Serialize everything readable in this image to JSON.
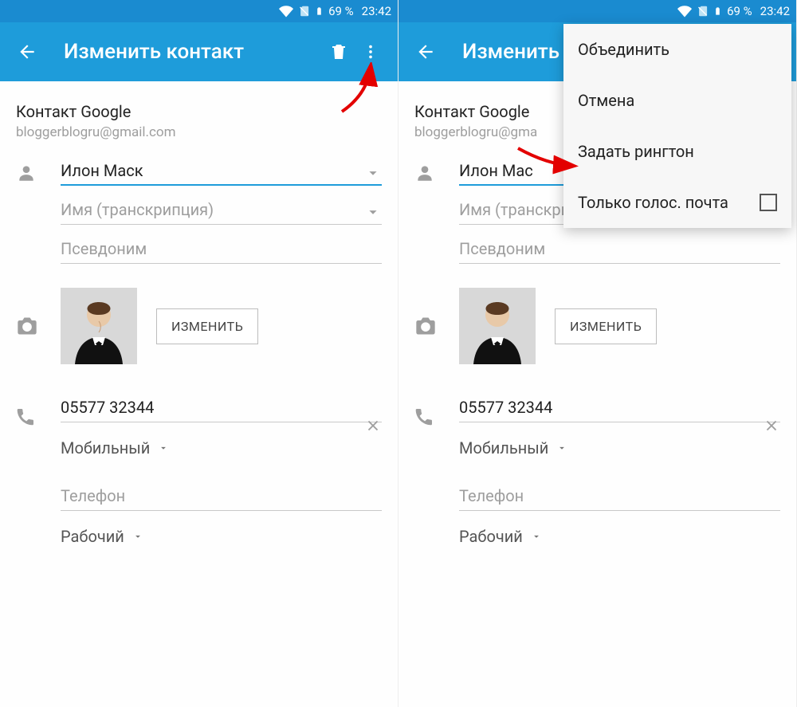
{
  "status": {
    "battery": "69 %",
    "time": "23:42"
  },
  "appbar": {
    "title": "Изменить контакт"
  },
  "account": {
    "label": "Контакт Google",
    "email": "bloggerblogru@gmail.com"
  },
  "fields": {
    "name_value": "Илон Маск",
    "name_value_trunc": "Илон Мас",
    "transcription_ph": "Имя (транскрипция)",
    "nickname_ph": "Псевдоним"
  },
  "photo": {
    "change_btn": "ИЗМЕНИТЬ"
  },
  "phone": {
    "value": "05577 32344",
    "type1": "Мобильный",
    "phone_ph": "Телефон",
    "type2": "Рабочий"
  },
  "menu": {
    "merge": "Объединить",
    "cancel": "Отмена",
    "ringtone": "Задать рингтон",
    "voicemail": "Только голос. почта"
  }
}
